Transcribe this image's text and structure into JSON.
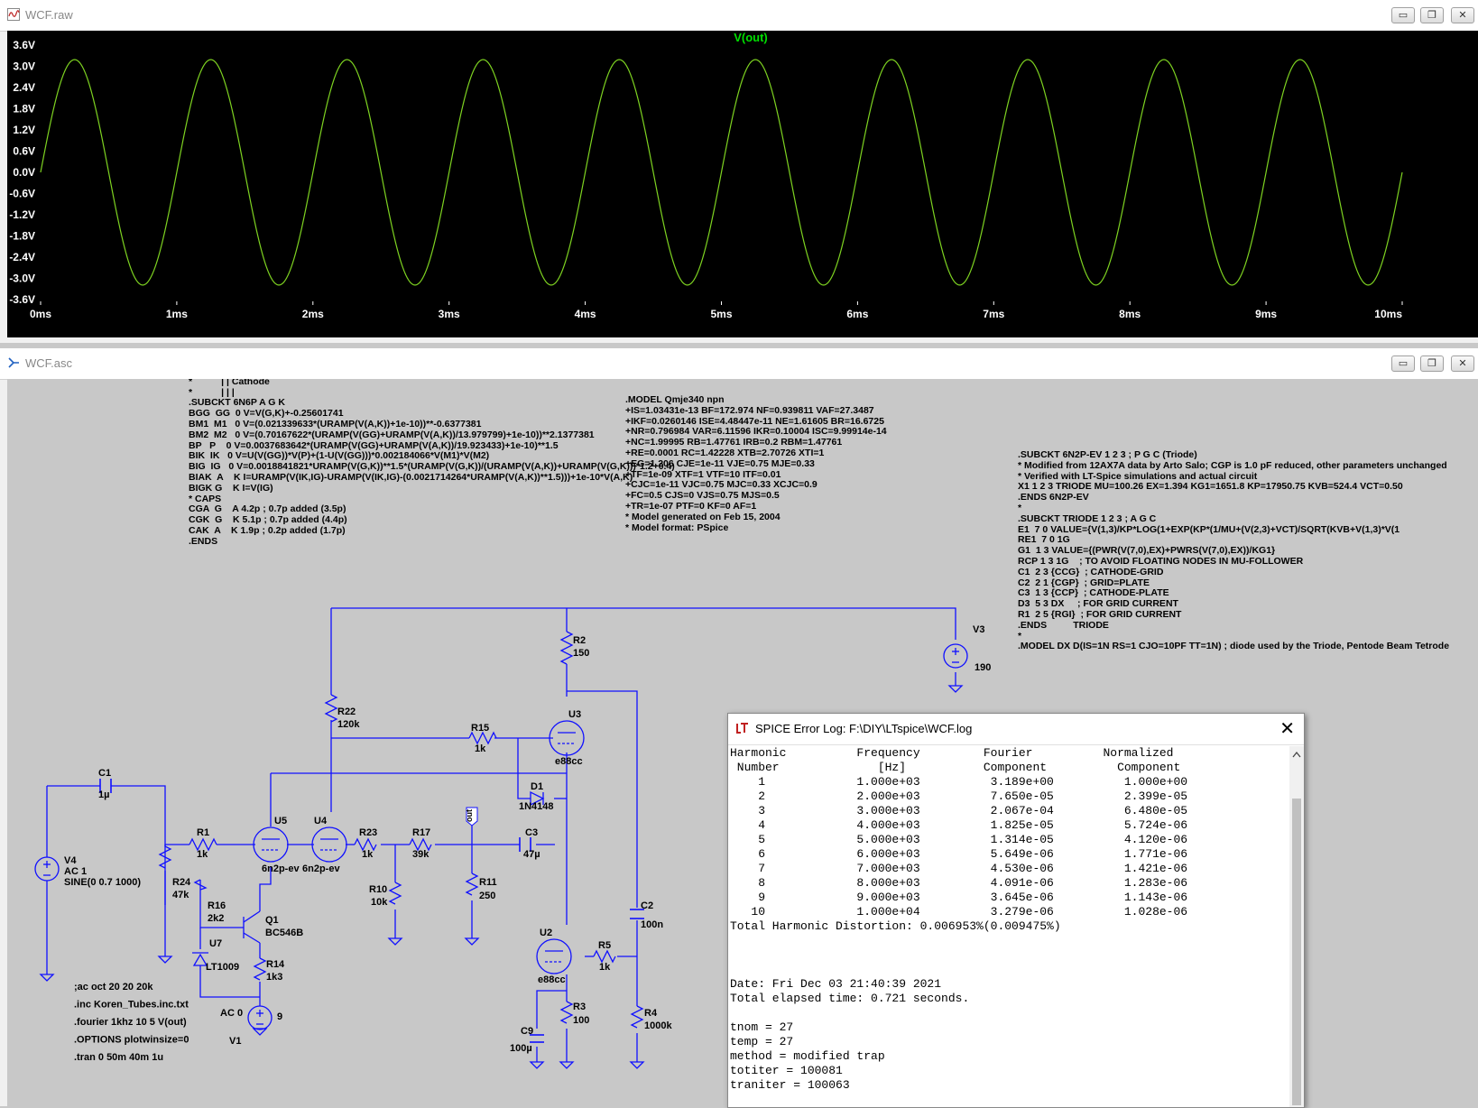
{
  "plot_window": {
    "title": "WCF.raw",
    "trace_label": "V(out)",
    "colors": {
      "background": "#000000",
      "trace": "#7ed321",
      "axis_text": "#ffffff",
      "trace_title": "#00e000"
    }
  },
  "chart_data": {
    "type": "line",
    "title": "V(out)",
    "series": [
      {
        "name": "V(out)",
        "frequency_hz": 1000,
        "amplitude_v": 3.189,
        "x_range_ms": [
          0,
          10
        ]
      }
    ],
    "ylim": [
      -3.6,
      3.6
    ],
    "y_ticks": [
      "3.6V",
      "3.0V",
      "2.4V",
      "1.8V",
      "1.2V",
      "0.6V",
      "0.0V",
      "-0.6V",
      "-1.2V",
      "-1.8V",
      "-2.4V",
      "-3.0V",
      "-3.6V"
    ],
    "x_ticks": [
      "0ms",
      "1ms",
      "2ms",
      "3ms",
      "4ms",
      "5ms",
      "6ms",
      "7ms",
      "8ms",
      "9ms",
      "10ms"
    ]
  },
  "schematic_window": {
    "title": "WCF.asc"
  },
  "schematic": {
    "text_6n6p": "           | Grid\n*           | | Cathode\n*           | | |\n.SUBCKT 6N6P A G K\nBGG  GG  0 V=V(G,K)+-0.25601741\nBM1  M1   0 V=(0.021339633*(URAMP(V(A,K))+1e-10))**-0.6377381\nBM2  M2   0 V=(0.70167622*(URAMP(V(GG)+URAMP(V(A,K))/13.979799)+1e-10))**2.1377381\nBP   P    0 V=0.0037683642*(URAMP(V(GG)+URAMP(V(A,K))/19.923433)+1e-10)**1.5\nBIK  IK   0 V=U(V(GG))*V(P)+(1-U(V(GG)))*0.002184066*V(M1)*V(M2)\nBIG  IG   0 V=0.0018841821*URAMP(V(G,K))**1.5*(URAMP(V(G,K))/(URAMP(V(A,K))+URAMP(V(G,K)))*1.2+0.4)\nBIAK  A    K I=URAMP(V(IK,IG)-URAMP(V(IK,IG)-(0.0021714264*URAMP(V(A,K))**1.5)))+1e-10*V(A,K)\nBIGK G    K I=V(IG)\n* CAPS\nCGA  G    A 4.2p ; 0.7p added (3.5p)\nCGK  G    K 5.1p ; 0.7p added (4.4p)\nCAK  A    K 1.9p ; 0.2p added (1.7p)\n.ENDS",
    "text_qmje": ".MODEL Qmje340 npn\n+IS=1.03431e-13 BF=172.974 NF=0.939811 VAF=27.3487\n+IKF=0.0260146 ISE=4.48447e-11 NE=1.61605 BR=16.6725\n+NR=0.796984 VAR=6.11596 IKR=0.10004 ISC=9.99914e-14\n+NC=1.99995 RB=1.47761 IRB=0.2 RBM=1.47761\n+RE=0.0001 RC=1.42228 XTB=2.70726 XTI=1\n+EG=1.206 CJE=1e-11 VJE=0.75 MJE=0.33\n+TF=1e-09 XTF=1 VTF=10 ITF=0.01\n+CJC=1e-11 VJC=0.75 MJC=0.33 XCJC=0.9\n+FC=0.5 CJS=0 VJS=0.75 MJS=0.5\n+TR=1e-07 PTF=0 KF=0 AF=1\n* Model generated on Feb 15, 2004\n* Model format: PSpice",
    "text_6n2p": ".SUBCKT 6N2P-EV 1 2 3 ; P G C (Triode)\n* Modified from 12AX7A data by Arto Salo; CGP is 1.0 pF reduced, other parameters unchanged\n* Verified with LT-Spice simulations and actual circuit\nX1 1 2 3 TRIODE MU=100.26 EX=1.394 KG1=1651.8 KP=17950.75 KVB=524.4 VCT=0.50\n.ENDS 6N2P-EV\n*\n.SUBCKT TRIODE 1 2 3 ; A G C\nE1  7 0 VALUE={V(1,3)/KP*LOG(1+EXP(KP*(1/MU+(V(2,3)+VCT)/SQRT(KVB+V(1,3)*V(1\nRE1  7 0 1G\nG1  1 3 VALUE={(PWR(V(7,0),EX)+PWRS(V(7,0),EX))/KG1}\nRCP 1 3 1G    ; TO AVOID FLOATING NODES IN MU-FOLLOWER\nC1  2 3 {CCG}  ; CATHODE-GRID\nC2  2 1 {CGP}  ; GRID=PLATE\nC3  1 3 {CCP}  ; CATHODE-PLATE\nD3  5 3 DX     ; FOR GRID CURRENT\nR1  2 5 {RGI}  ; FOR GRID CURRENT\n.ENDS          TRIODE\n*\n.MODEL DX D(IS=1N RS=1 CJO=10PF TT=1N) ; diode used by the Triode, Pentode Beam Tetrode",
    "directives": [
      ";ac oct 20 20 20k",
      ".inc Koren_Tubes.inc.txt",
      ".fourier 1khz 10  5  V(out)",
      ".OPTIONS plotwinsize=0",
      ".tran 0 50m 40m 1u"
    ],
    "components": {
      "C1": {
        "name": "C1",
        "value": "1µ"
      },
      "V4": {
        "name": "V4",
        "value1": "AC 1",
        "value2": "SINE(0 0.7 1000)"
      },
      "R1": {
        "name": "R1",
        "value": "1k"
      },
      "R24": {
        "name": "R24",
        "value": "47k"
      },
      "R16": {
        "name": "R16",
        "value": "2k2"
      },
      "Q1": {
        "name": "Q1",
        "value": "BC546B"
      },
      "U7": {
        "name": "U7",
        "value": "LT1009"
      },
      "R14": {
        "name": "R14",
        "value": "1k3"
      },
      "V1": {
        "name": "V1",
        "value1": "AC 0",
        "value2": "9"
      },
      "U5": {
        "name": "U5",
        "value": "6n2p-ev"
      },
      "U4": {
        "name": "U4",
        "value": "6n2p-ev"
      },
      "R22": {
        "name": "R22",
        "value": "120k"
      },
      "R23": {
        "name": "R23",
        "value": "1k"
      },
      "R17": {
        "name": "R17",
        "value": "39k"
      },
      "R10": {
        "name": "R10",
        "value": "10k"
      },
      "R11": {
        "name": "R11",
        "value": "250"
      },
      "R15": {
        "name": "R15",
        "value": "1k"
      },
      "C3": {
        "name": "C3",
        "value": "47µ"
      },
      "D1": {
        "name": "D1",
        "value": "1N4148"
      },
      "R2": {
        "name": "R2",
        "value": "150"
      },
      "U3": {
        "name": "U3",
        "value": "e88cc"
      },
      "V3": {
        "name": "V3",
        "value": "190"
      },
      "U2": {
        "name": "U2",
        "value": "e88cc"
      },
      "R5": {
        "name": "R5",
        "value": "1k"
      },
      "R3": {
        "name": "R3",
        "value": "100"
      },
      "C9": {
        "name": "C9",
        "value": "100µ"
      },
      "C2": {
        "name": "C2",
        "value": "100n"
      },
      "R4": {
        "name": "R4",
        "value": "1000k"
      },
      "out_label": "out"
    }
  },
  "error_log": {
    "title": "SPICE Error Log: F:\\DIY\\LTspice\\WCF.log",
    "content": "Harmonic          Frequency         Fourier          Normalized\n Number              [Hz]           Component          Component\n    1             1.000e+03          3.189e+00          1.000e+00\n    2             2.000e+03          7.650e-05          2.399e-05\n    3             3.000e+03          2.067e-04          6.480e-05\n    4             4.000e+03          1.825e-05          5.724e-06\n    5             5.000e+03          1.314e-05          4.120e-06\n    6             6.000e+03          5.649e-06          1.771e-06\n    7             7.000e+03          4.530e-06          1.421e-06\n    8             8.000e+03          4.091e-06          1.283e-06\n    9             9.000e+03          3.645e-06          1.143e-06\n   10             1.000e+04          3.279e-06          1.028e-06\nTotal Harmonic Distortion: 0.006953%(0.009475%)\n\n\n\nDate: Fri Dec 03 21:40:39 2021\nTotal elapsed time: 0.721 seconds.\n\ntnom = 27\ntemp = 27\nmethod = modified trap\ntotiter = 100081\ntraniter = 100063"
  },
  "window_buttons": {
    "minimize": "▭",
    "restore": "❐",
    "close": "✕"
  }
}
